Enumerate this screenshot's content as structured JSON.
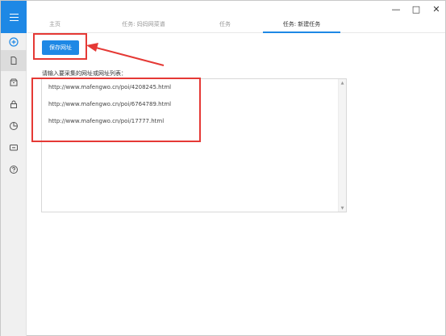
{
  "tabs": [
    {
      "label": "主页",
      "active": false
    },
    {
      "label": "任务: 妈妈网菜谱",
      "active": false
    },
    {
      "label": "任务",
      "active": false
    },
    {
      "label": "任务: 新建任务",
      "active": true
    }
  ],
  "window_controls": {
    "minimize": "—",
    "maximize": "□",
    "close": "✕"
  },
  "sidebar": {
    "items": [
      {
        "icon": "add-circle-icon",
        "active": false
      },
      {
        "icon": "document-icon",
        "active": true
      },
      {
        "icon": "box-icon",
        "active": false
      },
      {
        "icon": "lock-icon",
        "active": false
      },
      {
        "icon": "pie-chart-icon",
        "active": false
      },
      {
        "icon": "message-icon",
        "active": false
      },
      {
        "icon": "help-icon",
        "active": false
      }
    ]
  },
  "main": {
    "save_button": "保存网址",
    "url_label": "请输入要采集的网址或网址列表：",
    "urls": [
      "http://www.mafengwo.cn/poi/4208245.html",
      "http://www.mafengwo.cn/poi/6764789.html",
      "http://www.mafengwo.cn/poi/17777.html"
    ],
    "scroll_up": "▲",
    "scroll_down": "▼"
  },
  "colors": {
    "accent": "#1e88e5",
    "annotation": "#e53935"
  }
}
